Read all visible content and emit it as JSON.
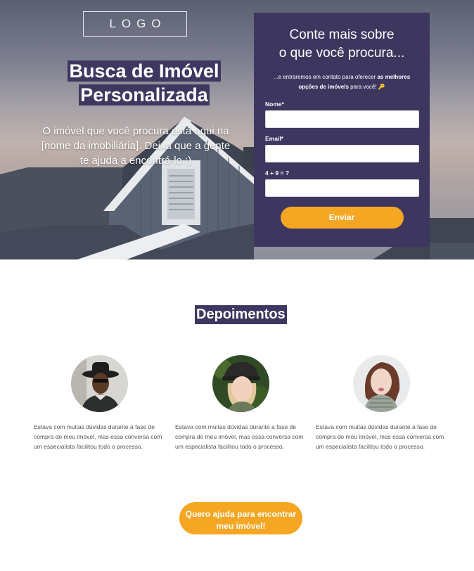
{
  "hero": {
    "logo": "LOGO",
    "title_line1": "Busca de Imóvel",
    "title_line2": "Personalizada",
    "subtitle": "O imóvel que você procura está aqui na [nome da imobiliária]. Deixa que a gente te ajuda a encontrá-lo :)"
  },
  "form": {
    "title_line1": "Conte mais sobre",
    "title_line2": "o que você procura...",
    "desc_prefix": "...e entraremos em contato para oferecer ",
    "desc_bold": "as melhores opções de imóvels",
    "desc_suffix": " para você! 🔑",
    "name_label": "Nome*",
    "email_label": "Email*",
    "captcha_label": "4 + 9 = ?",
    "submit_label": "Enviar"
  },
  "testimonials": {
    "title": "Depoimentos",
    "items": [
      {
        "text": "Estava com muitas dúvidas durante a fase de compra do meu imóvel, mas essa conversa com um especialista facilitou todo o processo."
      },
      {
        "text": "Estava com muitas dúvidas durante a fase de compra do meu imóvel, mas essa conversa com um especialista facilitou todo o processo."
      },
      {
        "text": "Estava com muitas dúvidas durante a fase de compra do meu imóvel, mas essa conversa com um especialista facilitou todo o processo."
      }
    ]
  },
  "cta": {
    "line1": "Quero ajuda para encontrar",
    "line2": "meu imóvel!"
  },
  "colors": {
    "primary": "#3d3760",
    "accent": "#f5a623"
  }
}
